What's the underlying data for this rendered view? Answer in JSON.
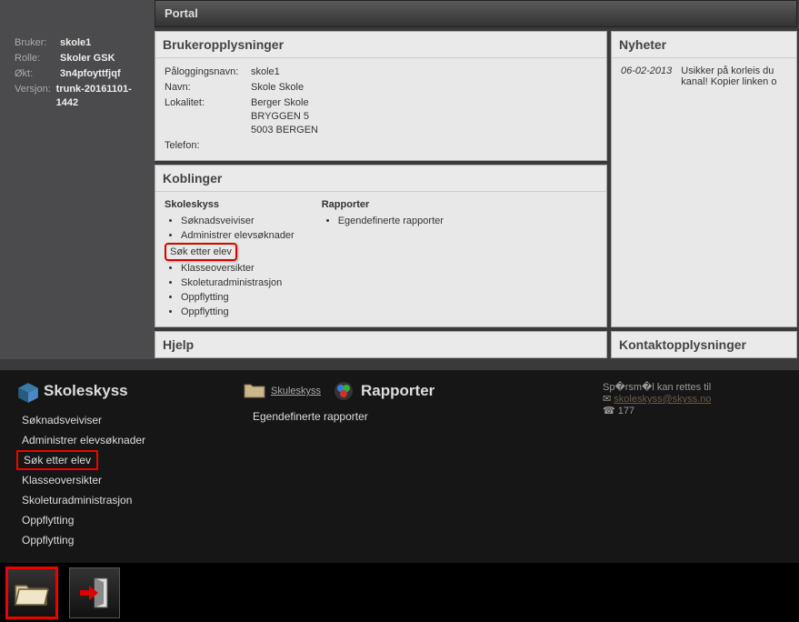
{
  "sidebar": {
    "rows": [
      {
        "label": "Bruker:",
        "value": "skole1"
      },
      {
        "label": "Rolle:",
        "value": "Skoler GSK"
      },
      {
        "label": "Økt:",
        "value": "3n4pfoyttfjqf"
      },
      {
        "label": "Versjon:",
        "value": "trunk-20161101-1442"
      }
    ]
  },
  "portal_title": "Portal",
  "user_panel": {
    "title": "Brukeropplysninger",
    "fields": {
      "login_label": "Påloggingsnavn:",
      "login_value": "skole1",
      "name_label": "Navn:",
      "name_value": "Skole Skole",
      "loc_label": "Lokalitet:",
      "loc_line1": "Berger Skole",
      "loc_line2": "BRYGGEN 5",
      "loc_line3": "5003 BERGEN",
      "phone_label": "Telefon:",
      "phone_value": ""
    }
  },
  "koblinger": {
    "title": "Koblinger",
    "col1_header": "Skoleskyss",
    "col1_items": [
      "Søknadsveiviser",
      "Administrer elevsøknader",
      "Søk etter elev",
      "Klasseoversikter",
      "Skoleturadministrasjon",
      "Oppflytting",
      "Oppflytting"
    ],
    "col1_highlight_index": 2,
    "col2_header": "Rapporter",
    "col2_items": [
      "Egendefinerte rapporter"
    ]
  },
  "hjelp": {
    "title": "Hjelp"
  },
  "nyheter": {
    "title": "Nyheter",
    "items": [
      {
        "date": "06-02-2013",
        "text": "Usikker på korleis du kanal! Kopier linken o"
      }
    ]
  },
  "kontakt": {
    "title": "Kontaktopplysninger",
    "line1": "Sp�rsm�l kan rettes til",
    "email": "skoleskyss@skyss.no",
    "phone": "177"
  },
  "overlay": {
    "section1": {
      "title": "Skoleskyss",
      "items": [
        "Søknadsveiviser",
        "Administrer elevsøknader",
        "Søk etter elev",
        "Klasseoversikter",
        "Skoleturadministrasjon",
        "Oppflytting",
        "Oppflytting"
      ],
      "highlight_index": 2
    },
    "section2": {
      "link_text": "Skuleskyss",
      "title": "Rapporter",
      "item": "Egendefinerte rapporter"
    }
  }
}
